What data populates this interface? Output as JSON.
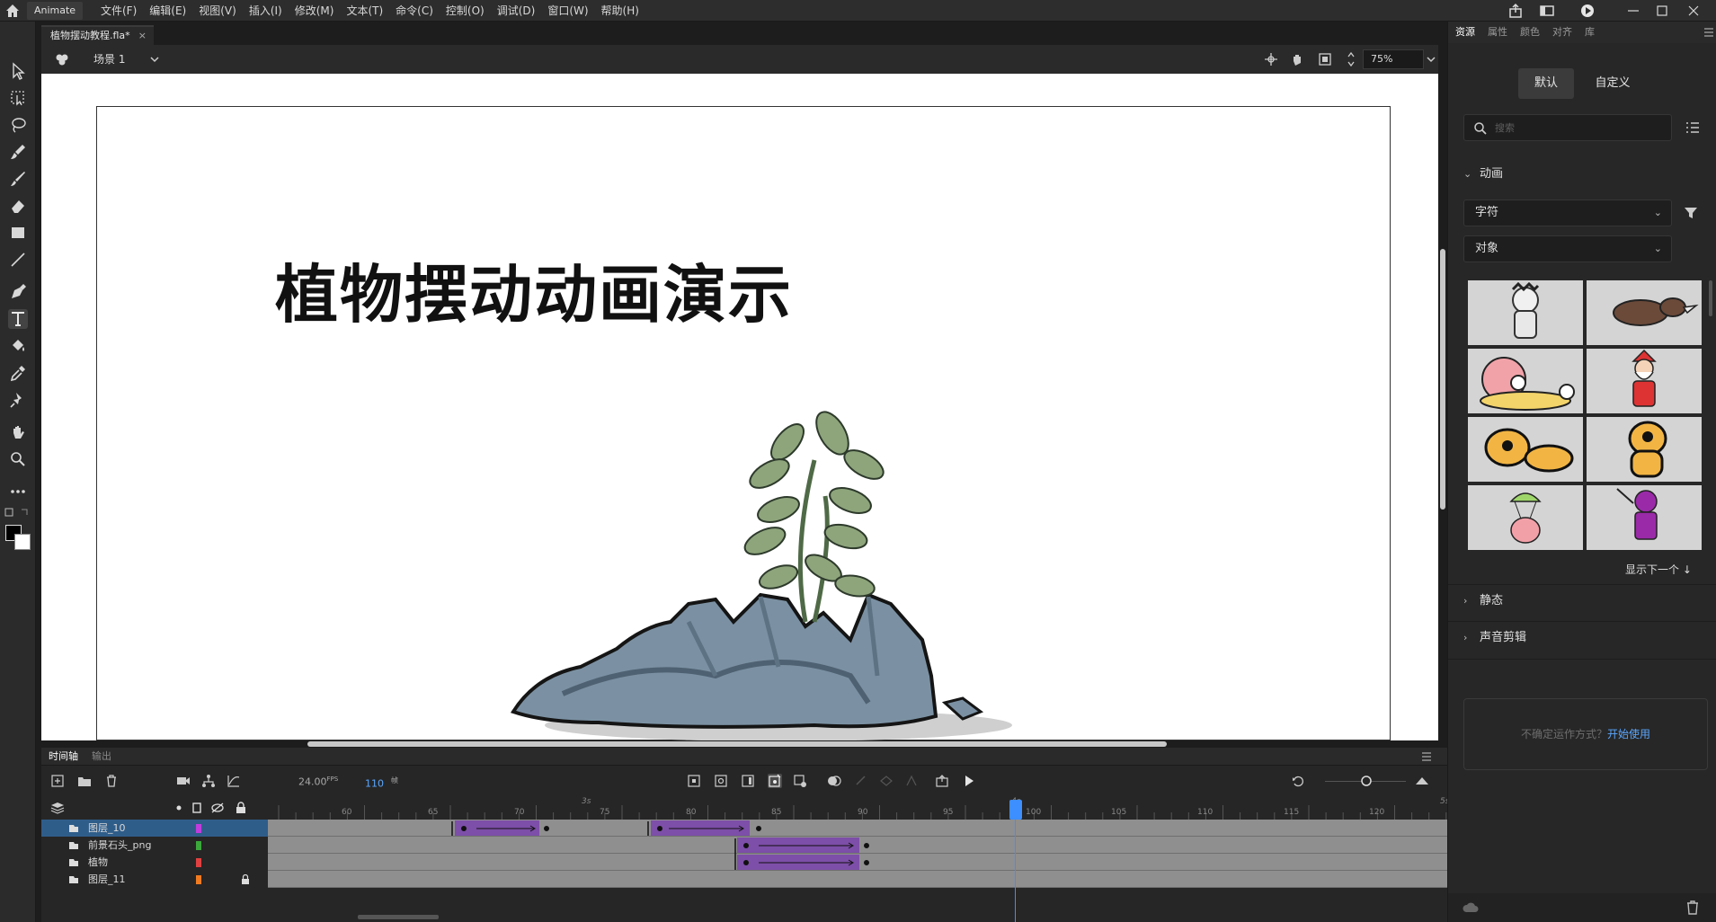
{
  "app": {
    "name": "Animate"
  },
  "menu": [
    "文件(F)",
    "编辑(E)",
    "视图(V)",
    "插入(I)",
    "修改(M)",
    "文本(T)",
    "命令(C)",
    "控制(O)",
    "调试(D)",
    "窗口(W)",
    "帮助(H)"
  ],
  "document": {
    "tab_name": "植物摆动教程.fla*",
    "close": "×"
  },
  "scene": {
    "name": "场景 1",
    "zoom": "75%"
  },
  "stage": {
    "title": "植物摆动动画演示"
  },
  "timeline": {
    "tab_timeline": "时间轴",
    "tab_output": "输出",
    "fps_value": "24.00",
    "fps_unit": "FPS",
    "current_frame": "110",
    "frame_unit": "帧",
    "ruler_frames": [
      "60",
      "65",
      "70",
      "75",
      "80",
      "85",
      "90",
      "95",
      "100",
      "105",
      "110",
      "115",
      "120"
    ],
    "ruler_seconds": [
      "3s",
      "4s",
      "5s"
    ],
    "layers": [
      {
        "name": "图层_10",
        "color": "#c03cdc",
        "locked": false,
        "selected": true
      },
      {
        "name": "前景石头_png",
        "color": "#3ca83c",
        "locked": false,
        "selected": false
      },
      {
        "name": "植物",
        "color": "#e04040",
        "locked": false,
        "selected": false
      },
      {
        "name": "图层_11",
        "color": "#f07a20",
        "locked": true,
        "selected": false
      }
    ]
  },
  "right_panel": {
    "tabs": [
      "资源",
      "属性",
      "颜色",
      "对齐",
      "库"
    ],
    "active_tab": "资源",
    "segment": {
      "default": "默认",
      "custom": "自定义"
    },
    "search_placeholder": "搜索",
    "section_animation": "动画",
    "dropdown_1": "字符",
    "dropdown_2": "对象",
    "show_next": "显示下一个",
    "section_static": "静态",
    "section_sound": "声音剪辑",
    "help_text": "不确定运作方式？",
    "help_link": "开始使用"
  },
  "colors": {
    "accent": "#5aa7ff",
    "selected_layer": "#2f5d8a",
    "tween": "#7d4fa8",
    "playhead": "#3d8eff"
  }
}
